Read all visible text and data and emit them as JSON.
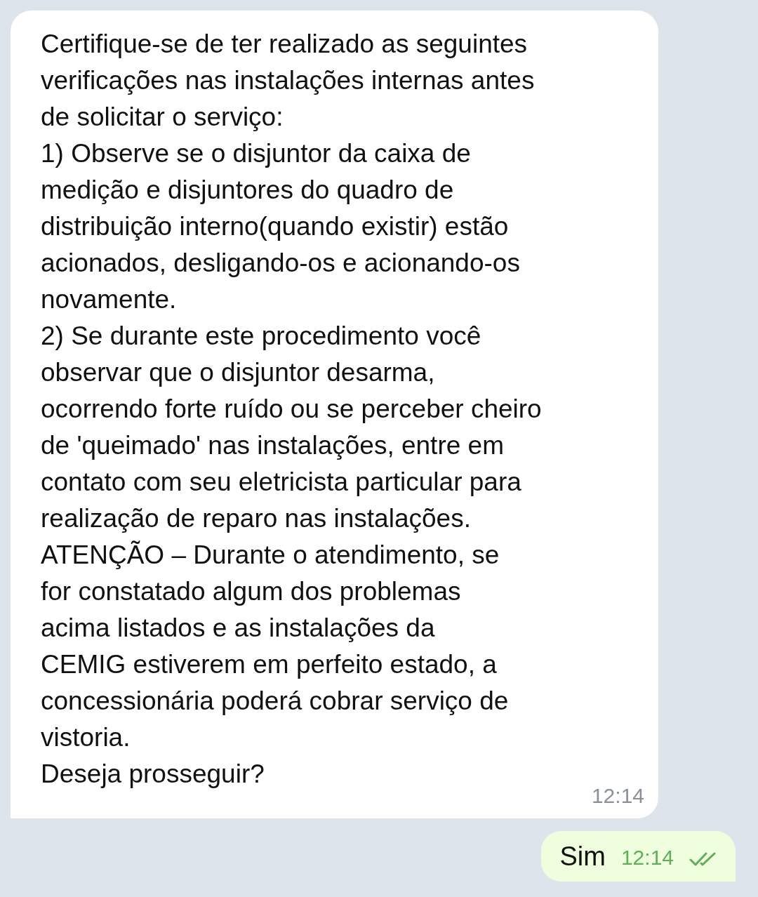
{
  "messages": [
    {
      "kind": "incoming",
      "time": "12:14",
      "lines": [
        "Certifique-se de ter realizado as seguintes",
        "verificações nas instalações internas antes",
        "de solicitar o serviço:",
        "1) Observe se o disjuntor da caixa de",
        "medição e disjuntores do quadro de",
        "distribuição interno(quando existir) estão",
        "acionados, desligando-os e acionando-os",
        "novamente.",
        "2) Se durante este procedimento você",
        "observar que o disjuntor desarma,",
        "ocorrendo forte ruído ou se perceber cheiro",
        "de 'queimado' nas instalações, entre em",
        "contato com seu eletricista particular para",
        "realização de reparo nas instalações.",
        "ATENÇÃO – Durante o atendimento, se",
        "for constatado algum dos problemas",
        "acima listados e as instalações da",
        "CEMIG estiverem em perfeito estado, a",
        "concessionária poderá cobrar serviço de",
        "vistoria.",
        "Deseja prosseguir?"
      ]
    },
    {
      "kind": "outgoing",
      "time": "12:14",
      "read": true,
      "lines": [
        "Sim"
      ]
    }
  ]
}
